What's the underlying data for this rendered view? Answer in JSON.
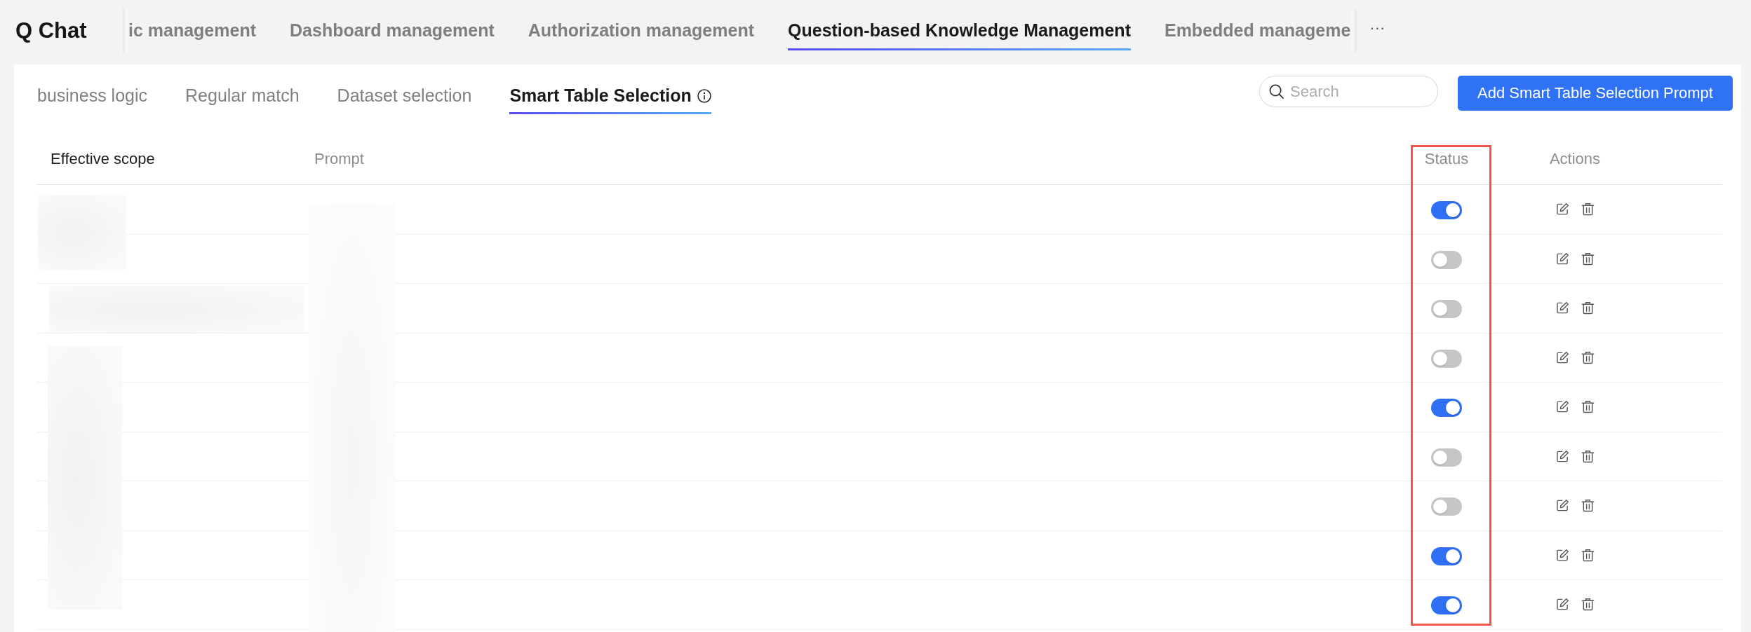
{
  "app": {
    "title": "Q Chat"
  },
  "top_tabs": [
    {
      "label": "ic management",
      "selected": false
    },
    {
      "label": "Dashboard management",
      "selected": false
    },
    {
      "label": "Authorization management",
      "selected": false
    },
    {
      "label": "Question-based Knowledge Management",
      "selected": true
    },
    {
      "label": "Embedded manageme",
      "selected": false
    }
  ],
  "more_tabs": {
    "label": "···"
  },
  "sub_tabs": [
    {
      "label": "business logic",
      "selected": false,
      "info_icon": false
    },
    {
      "label": "Regular match",
      "selected": false,
      "info_icon": false
    },
    {
      "label": "Dataset selection",
      "selected": false,
      "info_icon": false
    },
    {
      "label": "Smart Table Selection",
      "selected": true,
      "info_icon": true
    }
  ],
  "search": {
    "placeholder": "Search"
  },
  "add_button": {
    "label": "Add Smart Table Selection Prompt"
  },
  "table": {
    "content_blurred": true,
    "columns": [
      {
        "label": "Effective scope",
        "kind": "scope",
        "emphasized": true,
        "highlighted": false
      },
      {
        "label": "Prompt",
        "kind": "prompt",
        "emphasized": false,
        "highlighted": false
      },
      {
        "label": "Status",
        "kind": "status",
        "emphasized": false,
        "highlighted": true
      },
      {
        "label": "Actions",
        "kind": "actions",
        "emphasized": false,
        "highlighted": false
      }
    ],
    "rows": [
      {
        "enabled": true
      },
      {
        "enabled": false
      },
      {
        "enabled": false
      },
      {
        "enabled": false
      },
      {
        "enabled": true
      },
      {
        "enabled": false
      },
      {
        "enabled": false
      },
      {
        "enabled": true
      },
      {
        "enabled": true
      }
    ]
  }
}
